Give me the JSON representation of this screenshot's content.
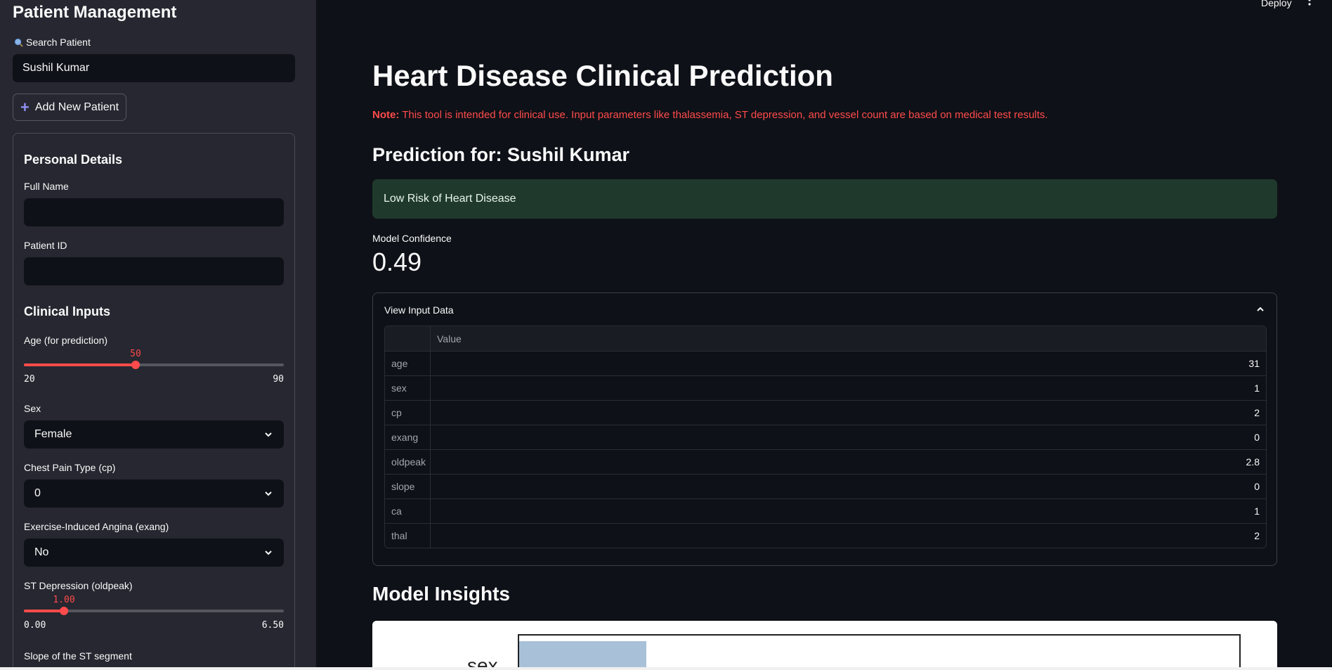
{
  "sidebar": {
    "title": "Patient Management",
    "search_label": "Search Patient",
    "search_value": "Sushil Kumar",
    "add_button": "Add New Patient",
    "personal_title": "Personal Details",
    "full_name_label": "Full Name",
    "patient_id_label": "Patient ID",
    "clinical_title": "Clinical Inputs",
    "age": {
      "label": "Age (for prediction)",
      "value": "50",
      "min": "20",
      "max": "90",
      "fraction": 0.4286
    },
    "sex": {
      "label": "Sex",
      "value": "Female"
    },
    "cp": {
      "label": "Chest Pain Type (cp)",
      "value": "0"
    },
    "exang": {
      "label": "Exercise-Induced Angina (exang)",
      "value": "No"
    },
    "oldpeak": {
      "label": "ST Depression (oldpeak)",
      "value": "1.00",
      "min": "0.00",
      "max": "6.50",
      "fraction": 0.1538
    },
    "slope_label": "Slope of the ST segment"
  },
  "header": {
    "deploy": "Deploy"
  },
  "main": {
    "title": "Heart Disease Clinical Prediction",
    "note_prefix": "Note:",
    "note_text": " This tool is intended for clinical use. Input parameters like thalassemia, ST depression, and vessel count are based on medical test results.",
    "prediction_title": "Prediction for: Sushil Kumar",
    "result": "Low Risk of Heart Disease",
    "metric_label": "Model Confidence",
    "metric_value": "0.49",
    "expander_label": "View Input Data",
    "table_header": "Value",
    "table_rows": [
      {
        "feature": "age",
        "value": "31"
      },
      {
        "feature": "sex",
        "value": "1"
      },
      {
        "feature": "cp",
        "value": "2"
      },
      {
        "feature": "exang",
        "value": "0"
      },
      {
        "feature": "oldpeak",
        "value": "2.8"
      },
      {
        "feature": "slope",
        "value": "0"
      },
      {
        "feature": "ca",
        "value": "1"
      },
      {
        "feature": "thal",
        "value": "2"
      }
    ],
    "insights_title": "Model Insights",
    "plot_tick": "sex"
  },
  "colors": {
    "accent": "#ff4b4b",
    "success_bg": "#1f3a2c",
    "bg": "#0e1117",
    "sidebar_bg": "#262730"
  }
}
